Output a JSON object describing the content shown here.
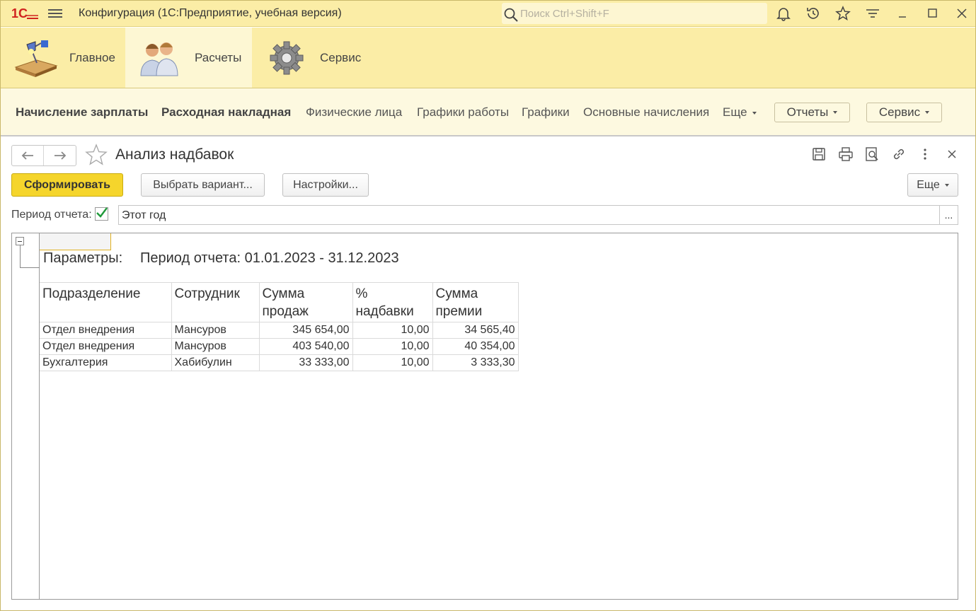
{
  "window": {
    "title": "Конфигурация  (1С:Предприятие, учебная версия)",
    "search_placeholder": "Поиск Ctrl+Shift+F",
    "accent": "#fbeda6"
  },
  "sections": [
    {
      "label": "Главное",
      "icon": "desk-lamp-icon",
      "active": false
    },
    {
      "label": "Расчеты",
      "icon": "people-icon",
      "active": true
    },
    {
      "label": "Сервис",
      "icon": "gear-icon",
      "active": false
    }
  ],
  "function_panel": {
    "links": [
      {
        "label": "Начисление зарплаты",
        "bold": true
      },
      {
        "label": "Расходная накладная",
        "bold": true
      },
      {
        "label": "Физические лица",
        "bold": false
      },
      {
        "label": "Графики работы",
        "bold": false
      },
      {
        "label": "Графики",
        "bold": false
      },
      {
        "label": "Основные начисления",
        "bold": false
      }
    ],
    "more_label": "Еще",
    "reports_label": "Отчеты",
    "service_label": "Сервис"
  },
  "form": {
    "title": "Анализ надбавок",
    "generate_label": "Сформировать",
    "choose_variant_label": "Выбрать вариант...",
    "settings_label": "Настройки...",
    "more_label": "Еще",
    "period_label": "Период отчета:",
    "period_checked": true,
    "period_value": "Этот год",
    "period_select_label": "..."
  },
  "report": {
    "params_label": "Параметры:",
    "params_value": "Период отчета: 01.01.2023 - 31.12.2023",
    "columns": [
      "Подразделение",
      "Сотрудник",
      "Сумма продаж",
      "% надбавки",
      "Сумма премии"
    ],
    "rows": [
      [
        "Отдел внедрения",
        "Мансуров",
        "345 654,00",
        "10,00",
        "34 565,40"
      ],
      [
        "Отдел внедрения",
        "Мансуров",
        "403 540,00",
        "10,00",
        "40 354,00"
      ],
      [
        "Бухгалтерия",
        "Хабибулин",
        "33 333,00",
        "10,00",
        "3 333,30"
      ]
    ]
  }
}
